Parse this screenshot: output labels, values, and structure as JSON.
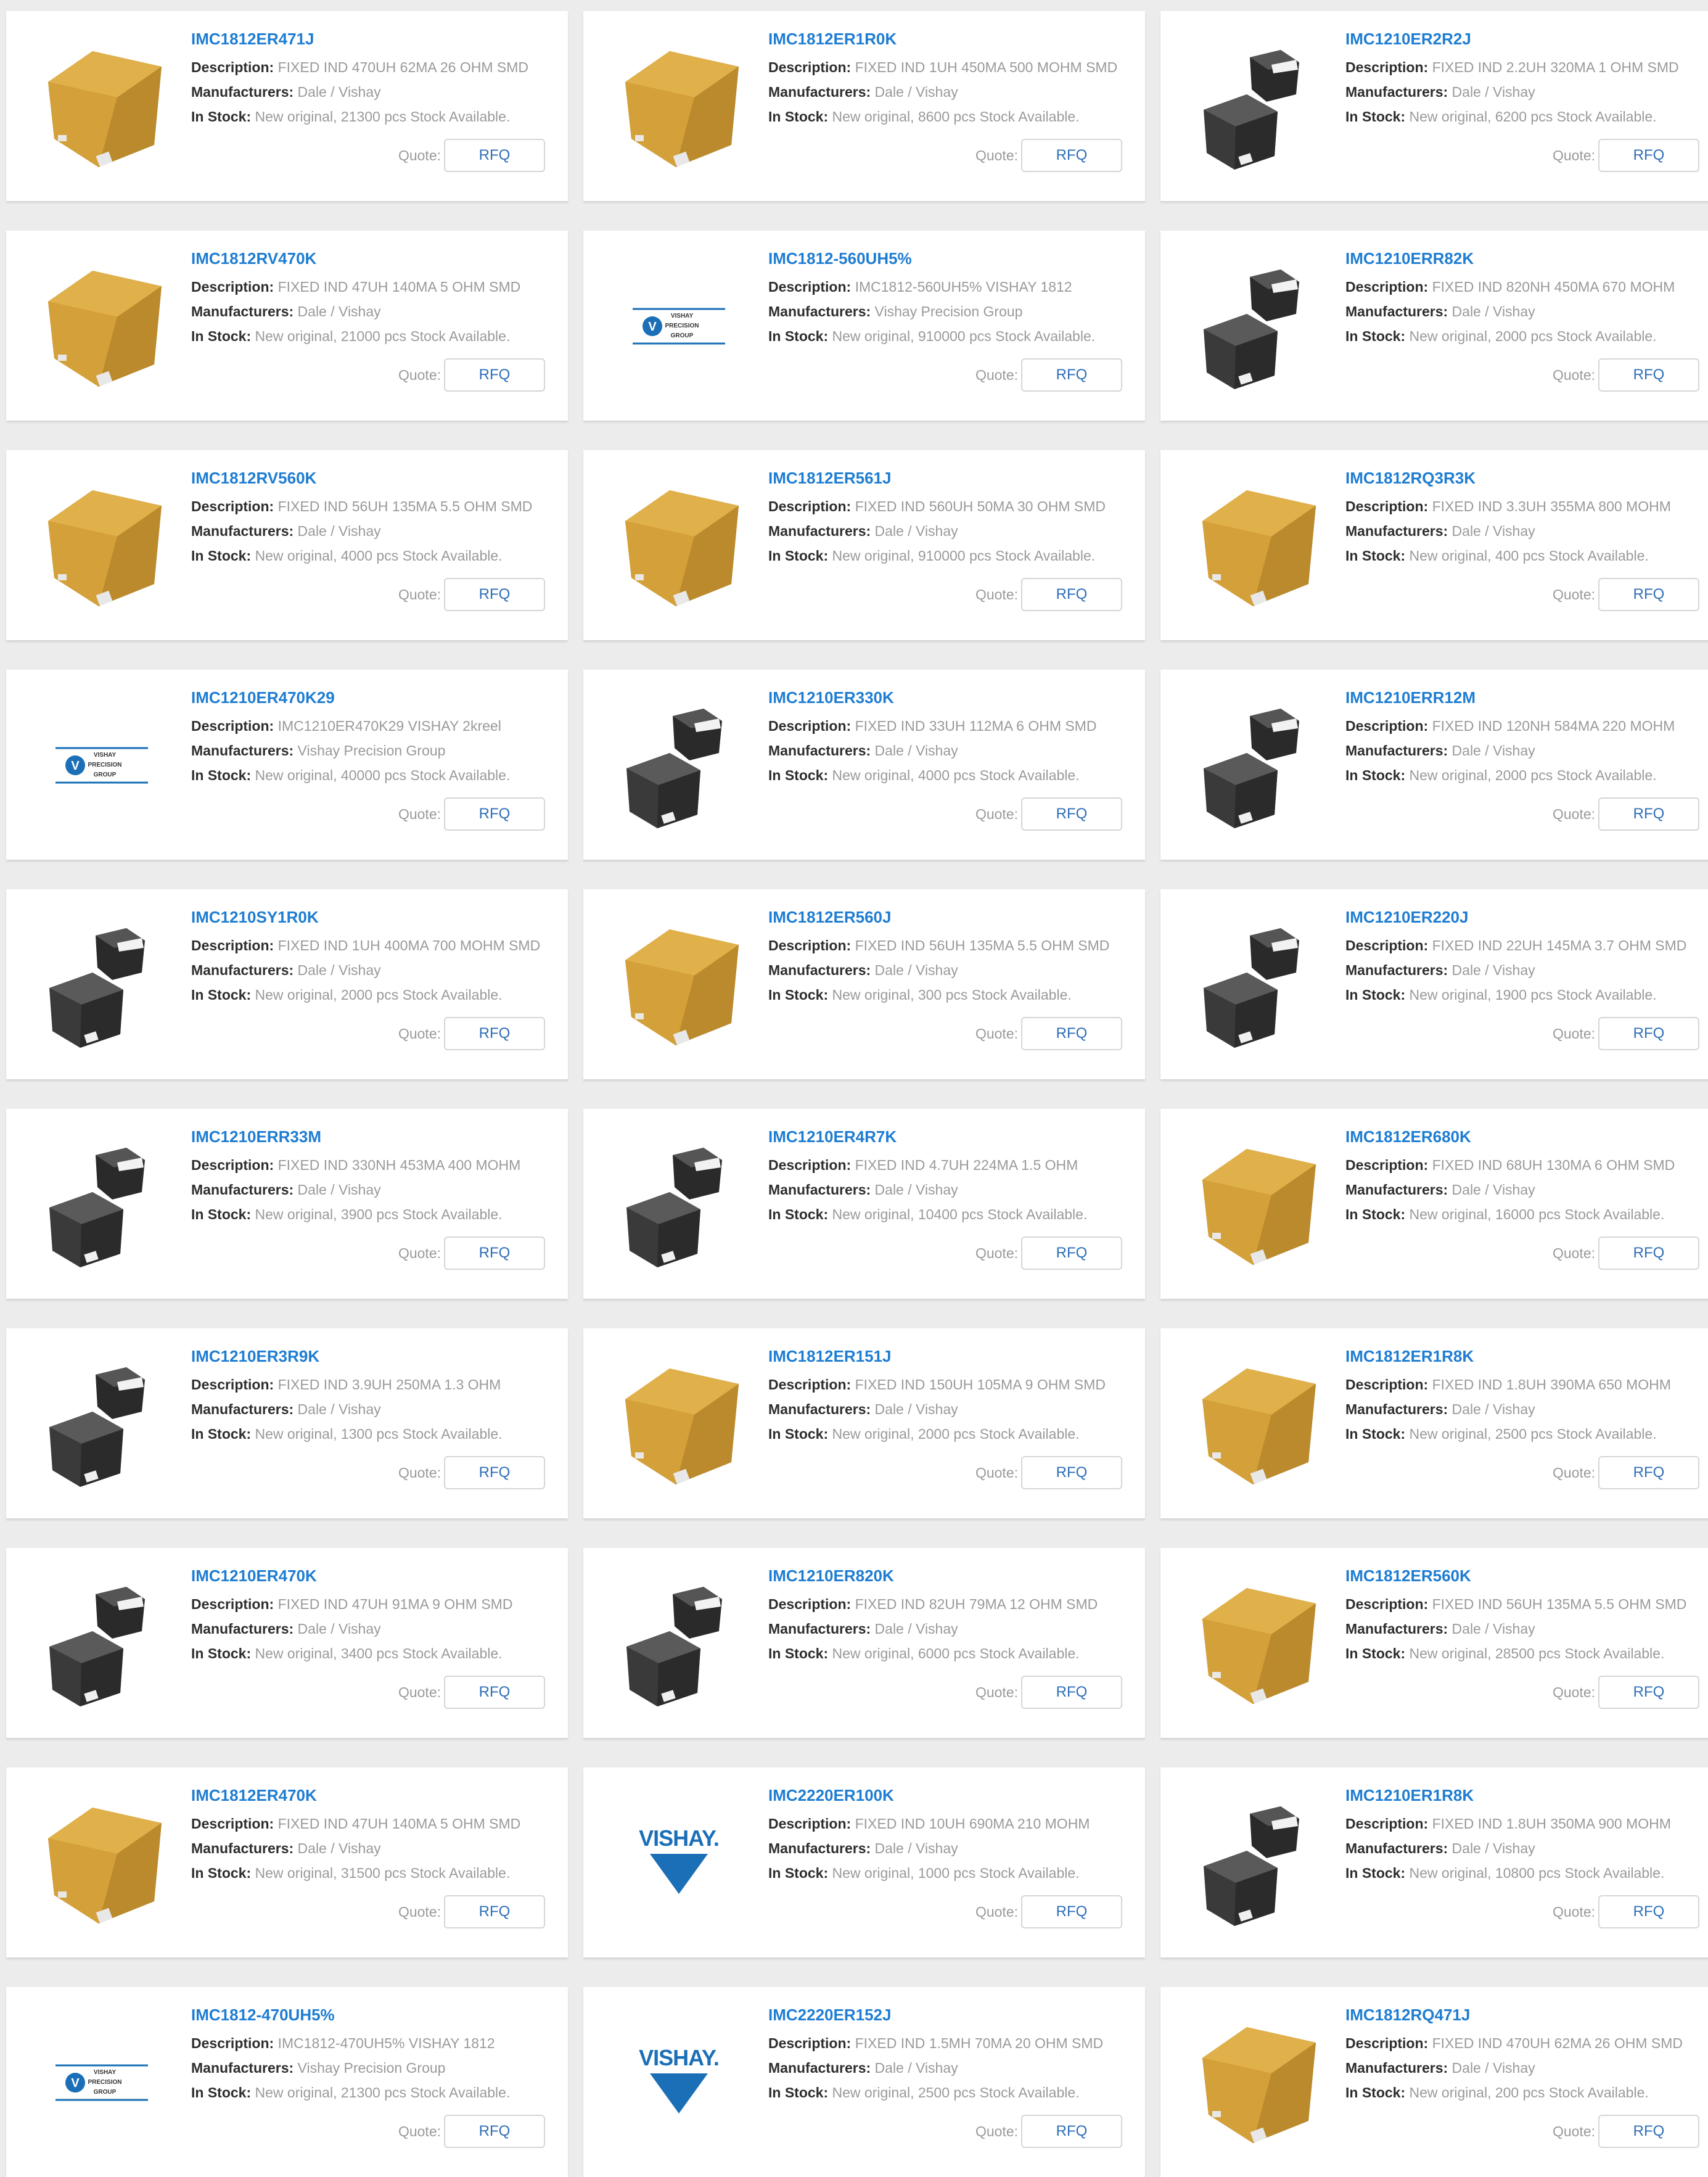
{
  "labels": {
    "description": "Description:",
    "manufacturers": "Manufacturers:",
    "in_stock": "In Stock:",
    "quote": "Quote:",
    "rfq": "RFQ"
  },
  "logo_text": {
    "vishay_precision": [
      "VISHAY",
      "PRECISION",
      "GROUP"
    ],
    "vishay": "VISHAY."
  },
  "colors": {
    "part_number": "#1e7dd2",
    "label": "#2e2e2e",
    "value": "#9a9a9a",
    "background": "#ececec",
    "inductor_body": "#d4a039",
    "chip_body": "#3a3a3a",
    "vishay_blue": "#1a6fb7"
  },
  "products": [
    {
      "part": "IMC1812ER471J",
      "description": "FIXED IND 470UH 62MA 26 OHM SMD",
      "manufacturer": "Dale / Vishay",
      "stock": "New original, 21300 pcs Stock Available.",
      "image": "yellow-inductor"
    },
    {
      "part": "IMC1812ER1R0K",
      "description": "FIXED IND 1UH 450MA 500 MOHM SMD",
      "manufacturer": "Dale / Vishay",
      "stock": "New original, 8600 pcs Stock Available.",
      "image": "yellow-inductor"
    },
    {
      "part": "IMC1210ER2R2J",
      "description": "FIXED IND 2.2UH 320MA 1 OHM SMD",
      "manufacturer": "Dale / Vishay",
      "stock": "New original, 6200 pcs Stock Available.",
      "image": "black-chip"
    },
    {
      "part": "IMC1812RV470K",
      "description": "FIXED IND 47UH 140MA 5 OHM SMD",
      "manufacturer": "Dale / Vishay",
      "stock": "New original, 21000 pcs Stock Available.",
      "image": "yellow-inductor"
    },
    {
      "part": "IMC1812-560UH5%",
      "description": "IMC1812-560UH5% VISHAY 1812",
      "manufacturer": "Vishay Precision Group",
      "stock": "New original, 910000 pcs Stock Available.",
      "image": "vishay-precision-logo"
    },
    {
      "part": "IMC1210ERR82K",
      "description": "FIXED IND 820NH 450MA 670 MOHM",
      "manufacturer": "Dale / Vishay",
      "stock": "New original, 2000 pcs Stock Available.",
      "image": "black-chip"
    },
    {
      "part": "IMC1812RV560K",
      "description": "FIXED IND 56UH 135MA 5.5 OHM SMD",
      "manufacturer": "Dale / Vishay",
      "stock": "New original, 4000 pcs Stock Available.",
      "image": "yellow-inductor"
    },
    {
      "part": "IMC1812ER561J",
      "description": "FIXED IND 560UH 50MA 30 OHM SMD",
      "manufacturer": "Dale / Vishay",
      "stock": "New original, 910000 pcs Stock Available.",
      "image": "yellow-inductor"
    },
    {
      "part": "IMC1812RQ3R3K",
      "description": "FIXED IND 3.3UH 355MA 800 MOHM",
      "manufacturer": "Dale / Vishay",
      "stock": "New original, 400 pcs Stock Available.",
      "image": "yellow-inductor"
    },
    {
      "part": "IMC1210ER470K29",
      "description": "IMC1210ER470K29 VISHAY 2kreel",
      "manufacturer": "Vishay Precision Group",
      "stock": "New original, 40000 pcs Stock Available.",
      "image": "vishay-precision-logo"
    },
    {
      "part": "IMC1210ER330K",
      "description": "FIXED IND 33UH 112MA 6 OHM SMD",
      "manufacturer": "Dale / Vishay",
      "stock": "New original, 4000 pcs Stock Available.",
      "image": "black-chip"
    },
    {
      "part": "IMC1210ERR12M",
      "description": "FIXED IND 120NH 584MA 220 MOHM",
      "manufacturer": "Dale / Vishay",
      "stock": "New original, 2000 pcs Stock Available.",
      "image": "black-chip"
    },
    {
      "part": "IMC1210SY1R0K",
      "description": "FIXED IND 1UH 400MA 700 MOHM SMD",
      "manufacturer": "Dale / Vishay",
      "stock": "New original, 2000 pcs Stock Available.",
      "image": "black-chip"
    },
    {
      "part": "IMC1812ER560J",
      "description": "FIXED IND 56UH 135MA 5.5 OHM SMD",
      "manufacturer": "Dale / Vishay",
      "stock": "New original, 300 pcs Stock Available.",
      "image": "yellow-inductor"
    },
    {
      "part": "IMC1210ER220J",
      "description": "FIXED IND 22UH 145MA 3.7 OHM SMD",
      "manufacturer": "Dale / Vishay",
      "stock": "New original, 1900 pcs Stock Available.",
      "image": "black-chip"
    },
    {
      "part": "IMC1210ERR33M",
      "description": "FIXED IND 330NH 453MA 400 MOHM",
      "manufacturer": "Dale / Vishay",
      "stock": "New original, 3900 pcs Stock Available.",
      "image": "black-chip"
    },
    {
      "part": "IMC1210ER4R7K",
      "description": "FIXED IND 4.7UH 224MA 1.5 OHM",
      "manufacturer": "Dale / Vishay",
      "stock": "New original, 10400 pcs Stock Available.",
      "image": "black-chip"
    },
    {
      "part": "IMC1812ER680K",
      "description": "FIXED IND 68UH 130MA 6 OHM SMD",
      "manufacturer": "Dale / Vishay",
      "stock": "New original, 16000 pcs Stock Available.",
      "image": "yellow-inductor"
    },
    {
      "part": "IMC1210ER3R9K",
      "description": "FIXED IND 3.9UH 250MA 1.3 OHM",
      "manufacturer": "Dale / Vishay",
      "stock": "New original, 1300 pcs Stock Available.",
      "image": "black-chip"
    },
    {
      "part": "IMC1812ER151J",
      "description": "FIXED IND 150UH 105MA 9 OHM SMD",
      "manufacturer": "Dale / Vishay",
      "stock": "New original, 2000 pcs Stock Available.",
      "image": "yellow-inductor"
    },
    {
      "part": "IMC1812ER1R8K",
      "description": "FIXED IND 1.8UH 390MA 650 MOHM",
      "manufacturer": "Dale / Vishay",
      "stock": "New original, 2500 pcs Stock Available.",
      "image": "yellow-inductor"
    },
    {
      "part": "IMC1210ER470K",
      "description": "FIXED IND 47UH 91MA 9 OHM SMD",
      "manufacturer": "Dale / Vishay",
      "stock": "New original, 3400 pcs Stock Available.",
      "image": "black-chip"
    },
    {
      "part": "IMC1210ER820K",
      "description": "FIXED IND 82UH 79MA 12 OHM SMD",
      "manufacturer": "Dale / Vishay",
      "stock": "New original, 6000 pcs Stock Available.",
      "image": "black-chip"
    },
    {
      "part": "IMC1812ER560K",
      "description": "FIXED IND 56UH 135MA 5.5 OHM SMD",
      "manufacturer": "Dale / Vishay",
      "stock": "New original, 28500 pcs Stock Available.",
      "image": "yellow-inductor"
    },
    {
      "part": "IMC1812ER470K",
      "description": "FIXED IND 47UH 140MA 5 OHM SMD",
      "manufacturer": "Dale / Vishay",
      "stock": "New original, 31500 pcs Stock Available.",
      "image": "yellow-inductor"
    },
    {
      "part": "IMC2220ER100K",
      "description": "FIXED IND 10UH 690MA 210 MOHM",
      "manufacturer": "Dale / Vishay",
      "stock": "New original, 1000 pcs Stock Available.",
      "image": "vishay-logo"
    },
    {
      "part": "IMC1210ER1R8K",
      "description": "FIXED IND 1.8UH 350MA 900 MOHM",
      "manufacturer": "Dale / Vishay",
      "stock": "New original, 10800 pcs Stock Available.",
      "image": "black-chip"
    },
    {
      "part": "IMC1812-470UH5%",
      "description": "IMC1812-470UH5% VISHAY 1812",
      "manufacturer": "Vishay Precision Group",
      "stock": "New original, 21300 pcs Stock Available.",
      "image": "vishay-precision-logo"
    },
    {
      "part": "IMC2220ER152J",
      "description": "FIXED IND 1.5MH 70MA 20 OHM SMD",
      "manufacturer": "Dale / Vishay",
      "stock": "New original, 2500 pcs Stock Available.",
      "image": "vishay-logo"
    },
    {
      "part": "IMC1812RQ471J",
      "description": "FIXED IND 470UH 62MA 26 OHM SMD",
      "manufacturer": "Dale / Vishay",
      "stock": "New original, 200 pcs Stock Available.",
      "image": "yellow-inductor"
    }
  ]
}
